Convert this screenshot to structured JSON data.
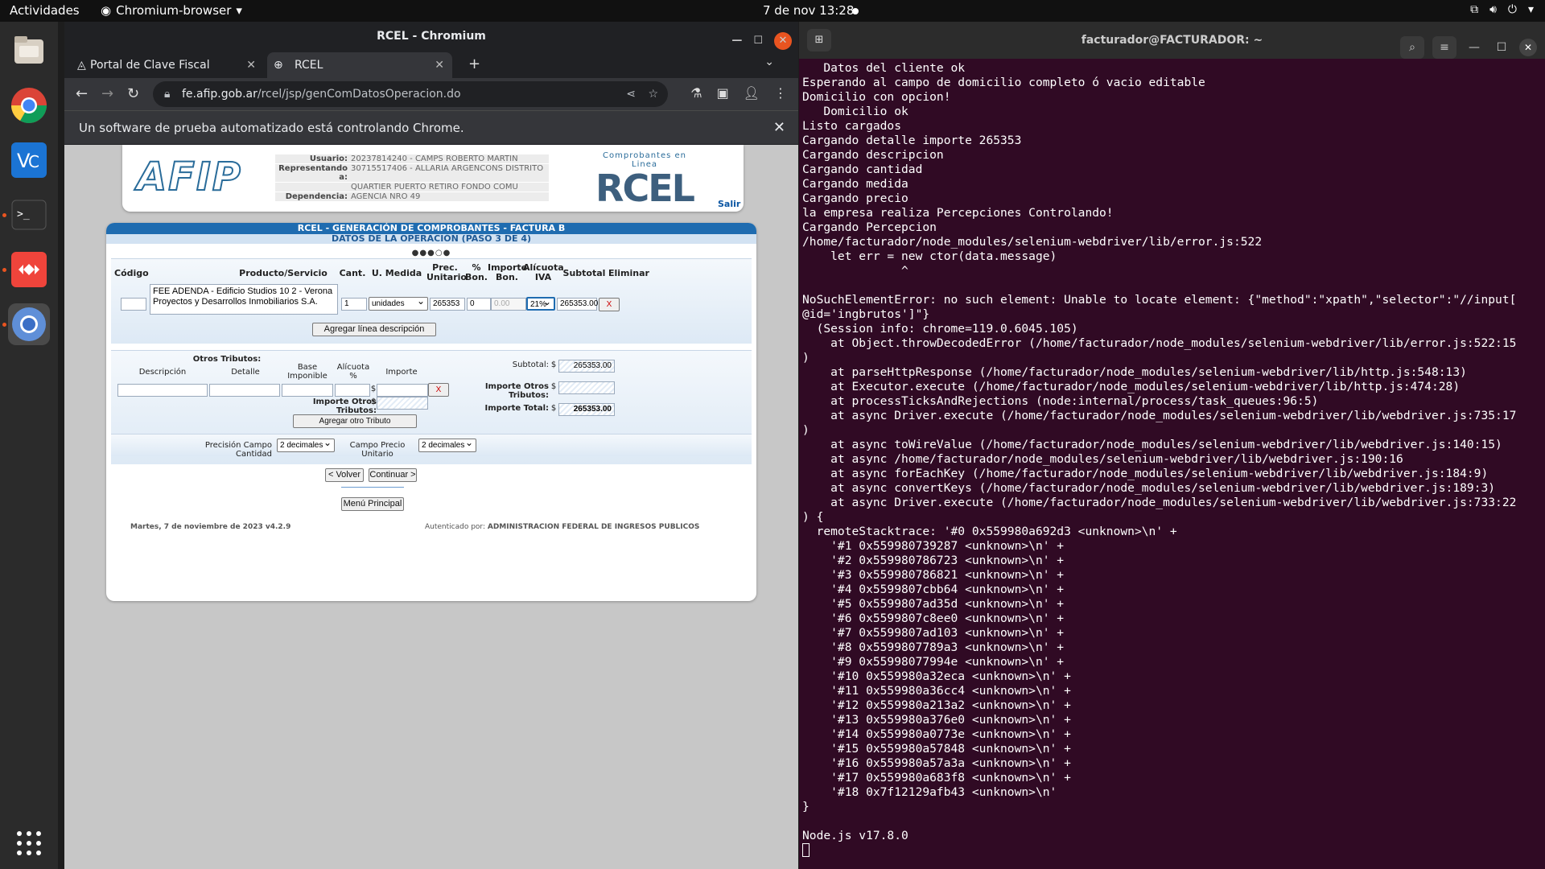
{
  "topbar": {
    "activities": "Actividades",
    "app_name": "Chromium-browser",
    "clock": "7 de nov  13:28"
  },
  "chrome": {
    "window_title": "RCEL - Chromium",
    "tabs": [
      {
        "label": "Portal de Clave Fiscal"
      },
      {
        "label": "RCEL"
      }
    ],
    "url_host": "fe.afip.gob.ar",
    "url_path": "/rcel/jsp/genComDatosOperacion.do",
    "infobar": "Un software de prueba automatizado está controlando Chrome."
  },
  "afip": {
    "logo": "AFIP",
    "usuario_label": "Usuario:",
    "usuario": "20237814240 - CAMPS ROBERTO MARTIN",
    "representando_label": "Representando a:",
    "representando_1": "30715517406 - ALLARIA ARGENCONS DISTRITO",
    "representando_2": "QUARTIER PUERTO RETIRO FONDO COMU",
    "dependencia_label": "Dependencia:",
    "dependencia": "AGENCIA NRO 49",
    "rcel_sub": "Comprobantes en Linea",
    "rcel_big": "RCEL",
    "salir": "Salir",
    "title1": "RCEL - GENERACIÓN DE COMPROBANTES - FACTURA B",
    "title2": "DATOS DE LA OPERACIÓN (PASO 3 DE 4)",
    "steps": "●●●○●",
    "cols": {
      "codigo": "Código",
      "producto": "Producto/Servicio",
      "cant": "Cant.",
      "umedida": "U. Medida",
      "prec1": "Prec.",
      "prec2": "Unitario",
      "bon1": "%",
      "bon2": "Bon.",
      "impbon1": "Importe",
      "impbon2": "Bon.",
      "ali1": "Alícuota",
      "ali2": "IVA",
      "subtotal": "Subtotal",
      "eliminar": "Eliminar"
    },
    "line": {
      "codigo": "",
      "descripcion": "FEE ADENDA - Edificio Studios 10 2 - Verona Proyectos y Desarrollos Inmobiliarios S.A.",
      "cantidad": "1",
      "umedida": "unidades",
      "precio": "265353",
      "bonif": "0",
      "importe_bon": "0.00",
      "alicuota": "21%",
      "subtotal": "265353.00",
      "eliminar": "X"
    },
    "agregar_linea": "Agregar línea descripción",
    "otros": {
      "title": "Otros Tributos:",
      "descripcion": "Descripción",
      "detalle": "Detalle",
      "base1": "Base",
      "base2": "Imponible",
      "ali1": "Alícuota",
      "ali2": "%",
      "importe": "Importe",
      "currency": "$",
      "eliminar": "X",
      "importe_otros_label": "Importe Otros Tributos:",
      "agregar": "Agregar otro Tributo"
    },
    "totals": {
      "subtotal_label": "Subtotal:",
      "subtotal": "265353.00",
      "otros_label": "Importe Otros Tributos:",
      "otros": "",
      "total_label": "Importe Total:",
      "total": "265353.00",
      "currency": "$"
    },
    "precision_cantidad_label": "Precisión Campo Cantidad",
    "precision_cantidad": "2 decimales",
    "precision_precio_label": "Campo Precio Unitario",
    "precision_precio": "2 decimales",
    "volver": "< Volver",
    "continuar": "Continuar >",
    "menu": "Menú Principal",
    "footer_left": "Martes, 7 de noviembre de 2023 v4.2.9",
    "footer_auth_label": "Autenticado por: ",
    "footer_auth": "ADMINISTRACION FEDERAL DE INGRESOS PUBLICOS"
  },
  "terminal": {
    "title": "facturador@FACTURADOR: ~",
    "lines": [
      "   Datos del cliente ok",
      "Esperando al campo de domicilio completo ó vacio editable",
      "Domicilio con opcion!",
      "   Domicilio ok",
      "Listo cargados",
      "Cargando detalle importe 265353",
      "Cargando descripcion",
      "Cargando cantidad",
      "Cargando medida",
      "Cargando precio",
      "la empresa realiza Percepciones Controlando!",
      "Cargando Percepcion",
      "/home/facturador/node_modules/selenium-webdriver/lib/error.js:522",
      "    let err = new ctor(data.message)",
      "              ^",
      "",
      "NoSuchElementError: no such element: Unable to locate element: {\"method\":\"xpath\",\"selector\":\"//input[",
      "@id='ingbrutos']\"}",
      "  (Session info: chrome=119.0.6045.105)",
      "    at Object.throwDecodedError (/home/facturador/node_modules/selenium-webdriver/lib/error.js:522:15",
      ")",
      "    at parseHttpResponse (/home/facturador/node_modules/selenium-webdriver/lib/http.js:548:13)",
      "    at Executor.execute (/home/facturador/node_modules/selenium-webdriver/lib/http.js:474:28)",
      "    at processTicksAndRejections (node:internal/process/task_queues:96:5)",
      "    at async Driver.execute (/home/facturador/node_modules/selenium-webdriver/lib/webdriver.js:735:17",
      ")",
      "    at async toWireValue (/home/facturador/node_modules/selenium-webdriver/lib/webdriver.js:140:15)",
      "    at async /home/facturador/node_modules/selenium-webdriver/lib/webdriver.js:190:16",
      "    at async forEachKey (/home/facturador/node_modules/selenium-webdriver/lib/webdriver.js:184:9)",
      "    at async convertKeys (/home/facturador/node_modules/selenium-webdriver/lib/webdriver.js:189:3)",
      "    at async Driver.execute (/home/facturador/node_modules/selenium-webdriver/lib/webdriver.js:733:22",
      ") {",
      "  remoteStacktrace: '#0 0x559980a692d3 <unknown>\\n' +",
      "    '#1 0x559980739287 <unknown>\\n' +",
      "    '#2 0x559980786723 <unknown>\\n' +",
      "    '#3 0x559980786821 <unknown>\\n' +",
      "    '#4 0x5599807cbb64 <unknown>\\n' +",
      "    '#5 0x5599807ad35d <unknown>\\n' +",
      "    '#6 0x5599807c8ee0 <unknown>\\n' +",
      "    '#7 0x5599807ad103 <unknown>\\n' +",
      "    '#8 0x5599807789a3 <unknown>\\n' +",
      "    '#9 0x55998077994e <unknown>\\n' +",
      "    '#10 0x559980a32eca <unknown>\\n' +",
      "    '#11 0x559980a36cc4 <unknown>\\n' +",
      "    '#12 0x559980a213a2 <unknown>\\n' +",
      "    '#13 0x559980a376e0 <unknown>\\n' +",
      "    '#14 0x559980a0773e <unknown>\\n' +",
      "    '#15 0x559980a57848 <unknown>\\n' +",
      "    '#16 0x559980a57a3a <unknown>\\n' +",
      "    '#17 0x559980a683f8 <unknown>\\n' +",
      "    '#18 0x7f12129afb43 <unknown>\\n'",
      "}",
      "",
      "Node.js v17.8.0"
    ]
  },
  "colors": {
    "terminal_bg": "#300a24",
    "ubuntu_orange": "#e95420",
    "afip_blue": "#1f6cb0"
  }
}
